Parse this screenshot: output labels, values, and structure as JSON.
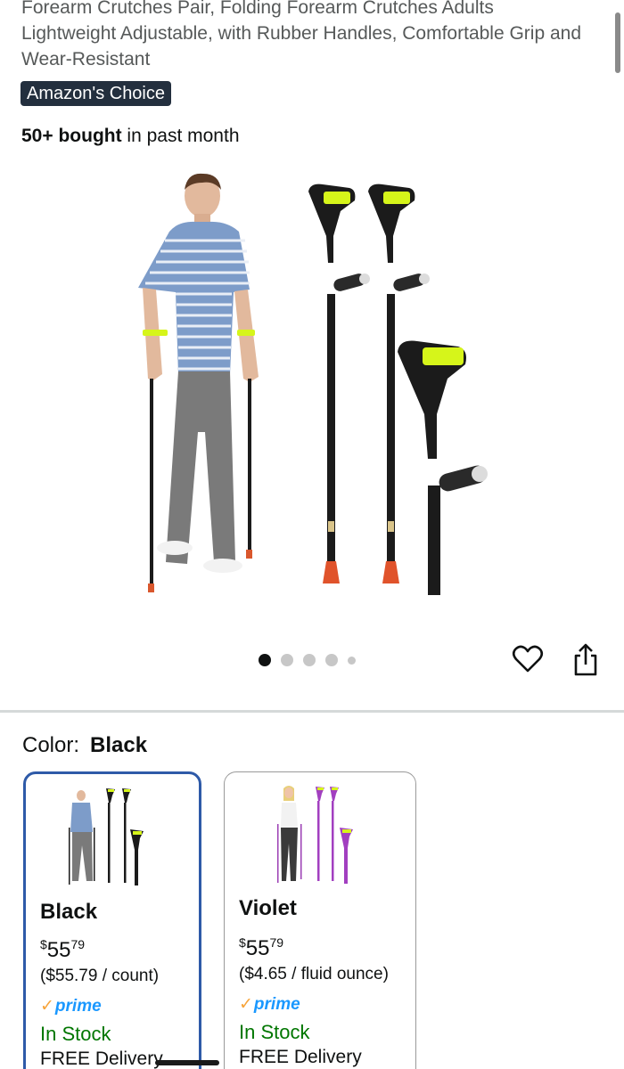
{
  "product": {
    "title": "Forearm Crutches Pair, Folding Forearm Crutches Adults Lightweight Adjustable, with Rubber Handles, Comfortable Grip and Wear-Resistant",
    "badge": "Amazon's Choice",
    "bought_bold": "50+ bought",
    "bought_rest": " in past month"
  },
  "gallery": {
    "image_count": 5,
    "active_index": 0,
    "image_alt": "Man walking with forearm crutches beside black folding forearm crutches"
  },
  "actions": {
    "favorite_icon": "heart-icon",
    "share_icon": "share-icon"
  },
  "color": {
    "label": "Color:",
    "selected": "Black"
  },
  "variants": [
    {
      "name": "Black",
      "price_symbol": "$",
      "price_whole": "55",
      "price_cents": "79",
      "unit_price": "($55.79 / count)",
      "prime_check": "✓",
      "prime_label": "prime",
      "stock": "In Stock",
      "delivery": "FREE Delivery",
      "selected": true
    },
    {
      "name": "Violet",
      "price_symbol": "$",
      "price_whole": "55",
      "price_cents": "79",
      "unit_price": "($4.65 / fluid ounce)",
      "prime_check": "✓",
      "prime_label": "prime",
      "stock": "In Stock",
      "delivery": "FREE Delivery",
      "selected": false
    }
  ],
  "colors": {
    "badge_bg": "#232f3e",
    "selected_border": "#2e5aa8",
    "prime_blue": "#1a98ff",
    "prime_check": "#f7a43a",
    "in_stock": "#007600"
  }
}
